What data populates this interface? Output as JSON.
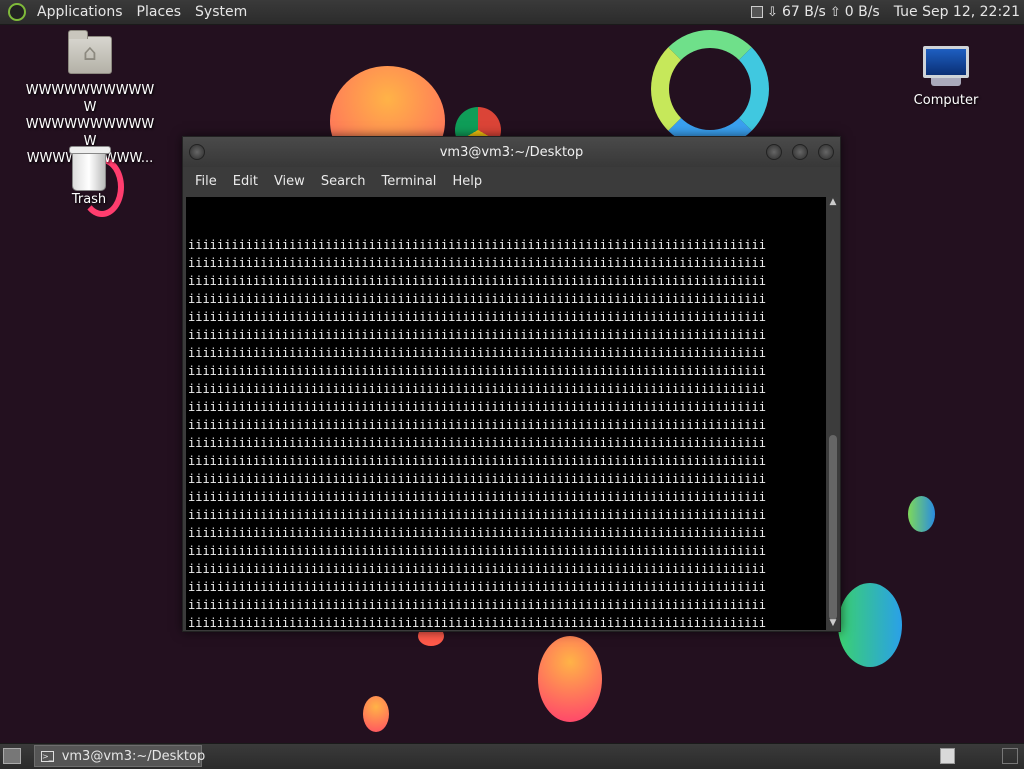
{
  "top_panel": {
    "menus": [
      "Applications",
      "Places",
      "System"
    ],
    "net_down": "67 B/s",
    "net_up": "0 B/s",
    "clock": "Tue Sep 12, 22:21"
  },
  "desktop": {
    "home_label": "WWWWWWWWWWW WWWWWWWWWWW WWWWWWWWW...",
    "trash_label": "Trash",
    "computer_label": "Computer"
  },
  "terminal": {
    "title": "vm3@vm3:~/Desktop",
    "menu": [
      "File",
      "Edit",
      "View",
      "Search",
      "Terminal",
      "Help"
    ],
    "full_line": "iiiiiiiiiiiiiiiiiiiiiiiiiiiiiiiiiiiiiiiiiiiiiiiiiiiiiiiiiiiiiiiiiiiiiiiiiiiiiiii",
    "last_line": "iiiiiiiiiiiiiiiiiii"
  },
  "taskbar": {
    "window_button": "vm3@vm3:~/Desktop"
  },
  "colors": {
    "desktop_bg": "#23101f",
    "panel_bg": "#2f2f2f",
    "terminal_bg": "#000000"
  }
}
